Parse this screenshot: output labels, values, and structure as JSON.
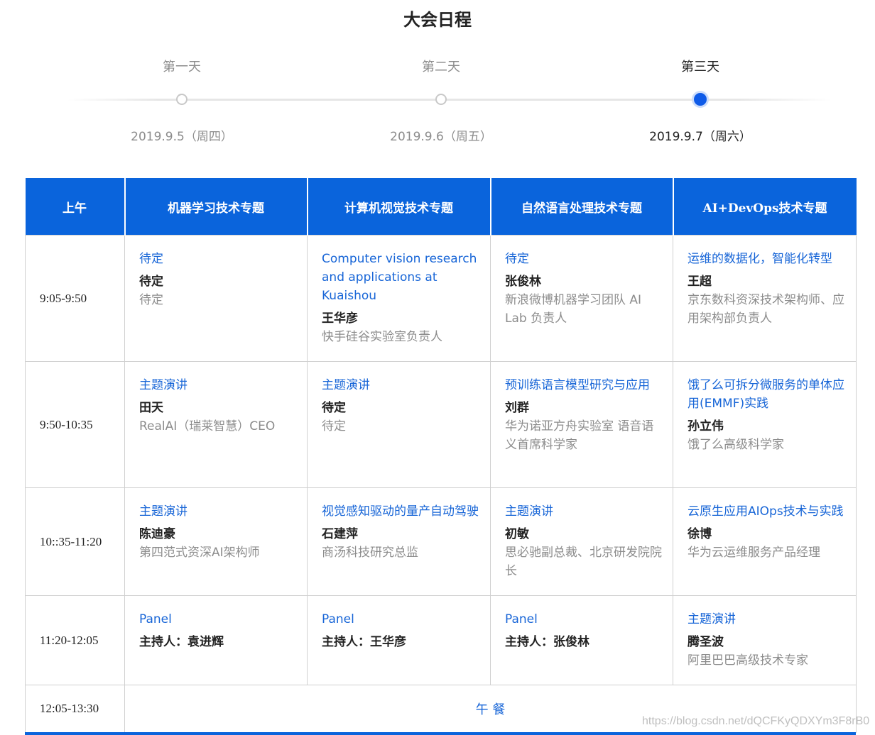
{
  "page": {
    "title": "大会日程"
  },
  "days": [
    {
      "label": "第一天",
      "date": "2019.9.5（周四）"
    },
    {
      "label": "第二天",
      "date": "2019.9.6（周五）"
    },
    {
      "label": "第三天",
      "date": "2019.9.7（周六）"
    }
  ],
  "active_day": "第三天",
  "table": {
    "headers": [
      "上午",
      "机器学习技术专题",
      "计算机视觉技术专题",
      "自然语言处理技术专题",
      "AI+DevOps技术专题"
    ],
    "rows": [
      {
        "time": "9:05-9:50",
        "sessions": [
          {
            "topic": "待定",
            "speaker": "待定",
            "title": "待定"
          },
          {
            "topic": "Computer vision research and applications at Kuaishou",
            "speaker": "王华彦",
            "title": "快手硅谷实验室负责人"
          },
          {
            "topic": "待定",
            "speaker": "张俊林",
            "title": "新浪微博机器学习团队 AI Lab 负责人"
          },
          {
            "topic": "运维的数据化，智能化转型",
            "speaker": "王超",
            "title": "京东数科资深技术架构师、应用架构部负责人"
          }
        ]
      },
      {
        "time": "9:50-10:35",
        "sessions": [
          {
            "topic": "主题演讲",
            "speaker": "田天",
            "title": "RealAI（瑞莱智慧）CEO"
          },
          {
            "topic": "主题演讲",
            "speaker": "待定",
            "title": "待定"
          },
          {
            "topic": "预训练语言模型研究与应用",
            "speaker": "刘群",
            "title": "华为诺亚方舟实验室 语音语义首席科学家"
          },
          {
            "topic": "饿了么可拆分微服务的单体应用(EMMF)实践",
            "speaker": "孙立伟",
            "title": "饿了么高级科学家"
          }
        ]
      },
      {
        "time": "10::35-11:20",
        "sessions": [
          {
            "topic": "主题演讲",
            "speaker": "陈迪豪",
            "title": "第四范式资深AI架构师"
          },
          {
            "topic": "视觉感知驱动的量产自动驾驶",
            "speaker": "石建萍",
            "title": "商汤科技研究总监"
          },
          {
            "topic": "主题演讲",
            "speaker": "初敏",
            "title": "思必驰副总裁、北京研发院院长"
          },
          {
            "topic": "云原生应用AIOps技术与实践",
            "speaker": "徐博",
            "title": "华为云运维服务产品经理"
          }
        ]
      },
      {
        "time": "11:20-12:05",
        "sessions": [
          {
            "topic": "Panel",
            "speaker": "主持人：袁进辉",
            "title": ""
          },
          {
            "topic": "Panel",
            "speaker": "主持人：王华彦",
            "title": ""
          },
          {
            "topic": "Panel",
            "speaker": "主持人：张俊林",
            "title": ""
          },
          {
            "topic": "主题演讲",
            "speaker": "腾圣波",
            "title": "阿里巴巴高级技术专家"
          }
        ]
      }
    ],
    "lunch": {
      "time": "12:05-13:30",
      "label": "午 餐"
    }
  },
  "watermark": "https://blog.csdn.net/dQCFKyQDXYm3F8rB0",
  "colors": {
    "header_bg": "#0a64dc",
    "link": "#1765d7",
    "active_dot": "#0f5be8",
    "muted": "#8c8c8c"
  }
}
